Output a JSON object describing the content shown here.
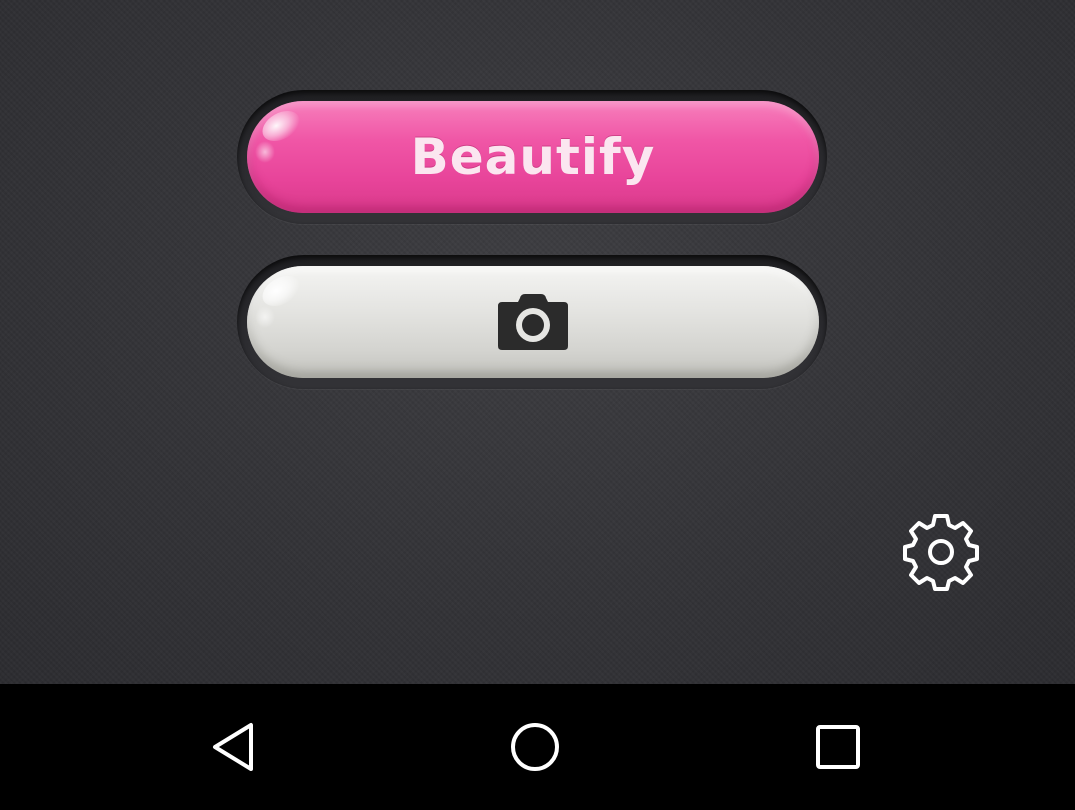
{
  "main": {
    "beautify_button": {
      "label": "Beautify",
      "color": "#f056a6"
    },
    "camera_button": {
      "icon": "camera-icon",
      "color": "#e4e4e1"
    },
    "settings": {
      "icon": "gear-icon"
    }
  },
  "nav_bar": {
    "items": [
      {
        "icon": "back-triangle-icon"
      },
      {
        "icon": "home-circle-icon"
      },
      {
        "icon": "recent-apps-square-icon"
      }
    ]
  },
  "colors": {
    "background": "#333337",
    "accent_pink": "#f056a6",
    "nav_bar": "#000000",
    "icon_white": "#ffffff"
  }
}
